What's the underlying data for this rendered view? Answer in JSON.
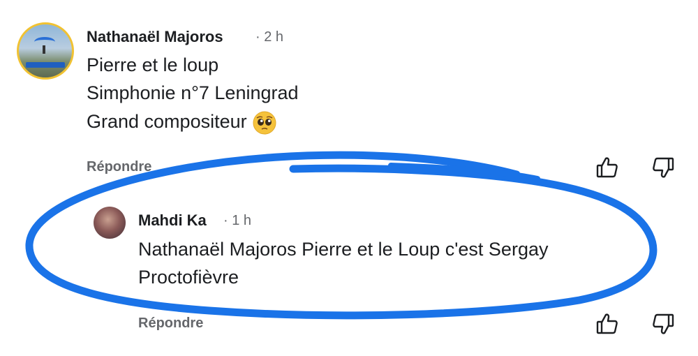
{
  "comments": [
    {
      "author": "Nathanaël Majoros",
      "time": "· 2 h",
      "lines": [
        "Pierre et le loup",
        "Simphonie n°7 Leningrad",
        "Grand compositeur"
      ],
      "emoji": "pleading-face-emoji",
      "reply_label": "Répondre"
    },
    {
      "author": "Mahdi Ka",
      "time": "· 1 h",
      "lines": [
        "Nathanaël Majoros Pierre et le Loup c'est Sergay",
        "Proctofièvre"
      ],
      "reply_label": "Répondre"
    }
  ],
  "icons": {
    "like": "thumbs-up-icon",
    "dislike": "thumbs-down-icon"
  },
  "colors": {
    "highlight": "#1a73e8",
    "meta_text": "#65676b",
    "avatar_ring": "#f1c232"
  }
}
